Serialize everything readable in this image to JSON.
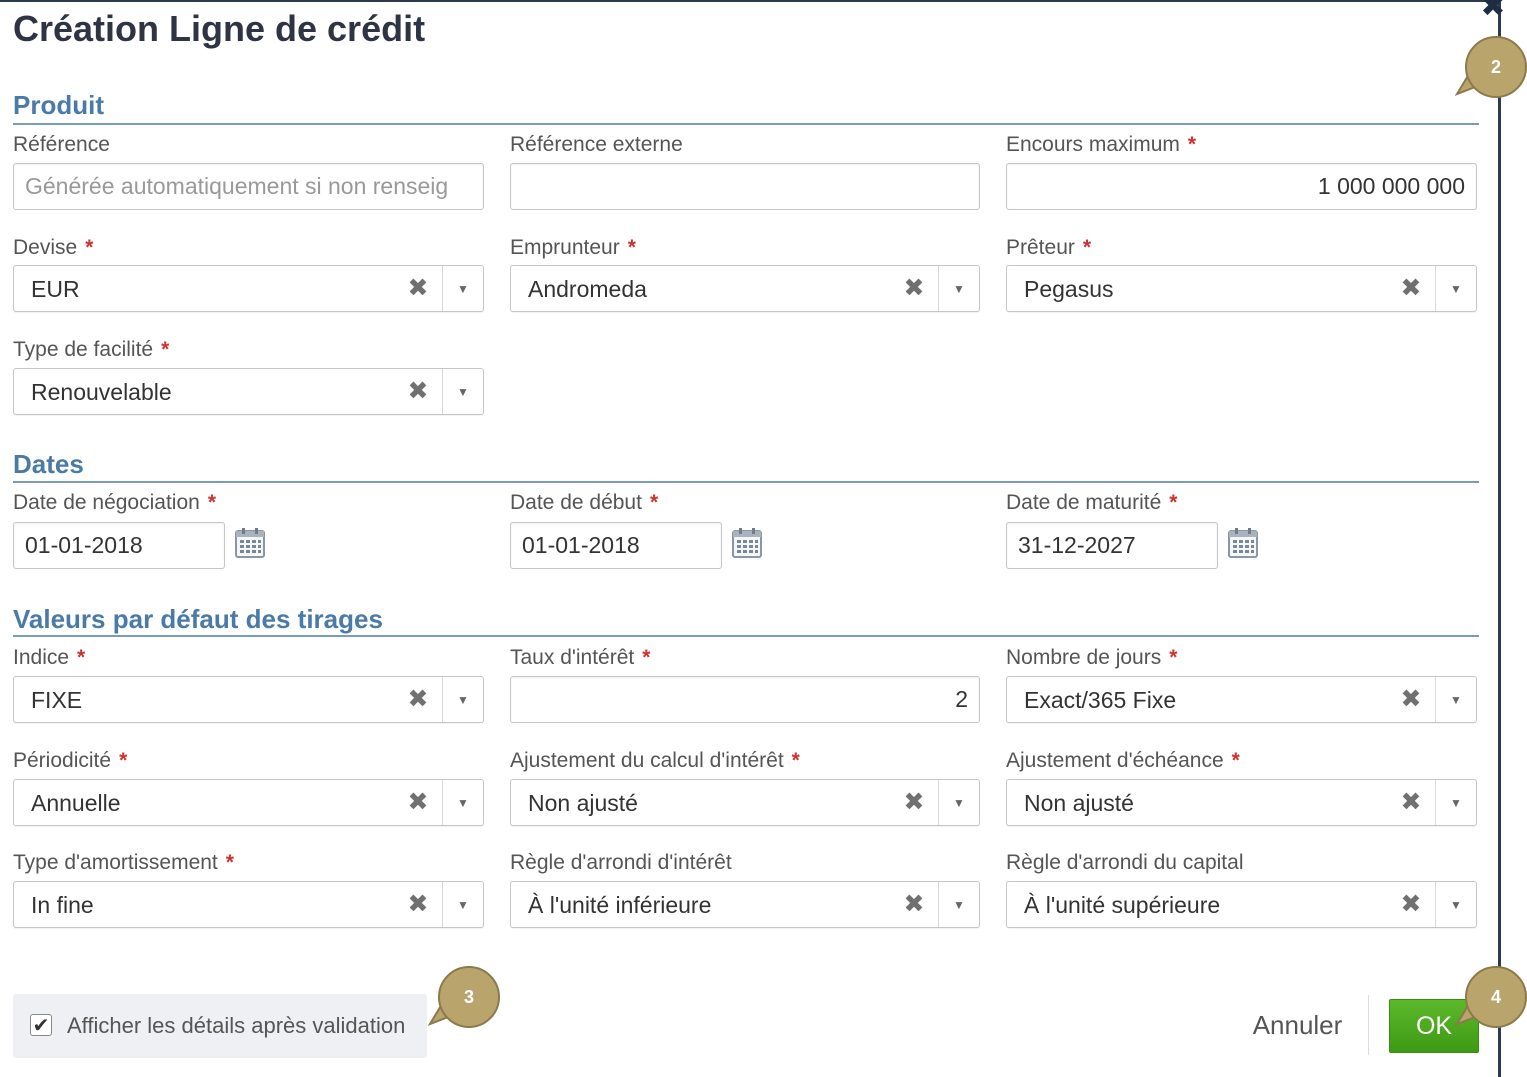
{
  "dialog": {
    "title": "Création Ligne de crédit",
    "close_icon": "close-icon"
  },
  "required_mark": "*",
  "sections": {
    "produit": "Produit",
    "dates": "Dates",
    "tirages": "Valeurs par défaut des tirages"
  },
  "produit": {
    "reference": {
      "label": "Référence",
      "placeholder": "Générée automatiquement si non renseig",
      "value": ""
    },
    "reference_externe": {
      "label": "Référence externe",
      "value": ""
    },
    "encours_maximum": {
      "label": "Encours maximum",
      "value": "1 000 000 000"
    },
    "devise": {
      "label": "Devise",
      "value": "EUR"
    },
    "emprunteur": {
      "label": "Emprunteur",
      "value": "Andromeda"
    },
    "preteur": {
      "label": "Prêteur",
      "value": "Pegasus"
    },
    "type_facilite": {
      "label": "Type de facilité",
      "value": "Renouvelable"
    }
  },
  "dates": {
    "negociation": {
      "label": "Date de négociation",
      "value": "01-01-2018"
    },
    "debut": {
      "label": "Date de début",
      "value": "01-01-2018"
    },
    "maturite": {
      "label": "Date de maturité",
      "value": "31-12-2027"
    }
  },
  "tirages": {
    "indice": {
      "label": "Indice",
      "value": "FIXE"
    },
    "taux_interet": {
      "label": "Taux d'intérêt",
      "value": "2"
    },
    "nombre_jours": {
      "label": "Nombre de jours",
      "value": "Exact/365 Fixe"
    },
    "periodicite": {
      "label": "Périodicité",
      "value": "Annuelle"
    },
    "ajustement_calcul": {
      "label": "Ajustement du calcul d'intérêt",
      "value": "Non ajusté"
    },
    "ajustement_echeance": {
      "label": "Ajustement d'échéance",
      "value": "Non ajusté"
    },
    "type_amortissement": {
      "label": "Type d'amortissement",
      "value": "In fine"
    },
    "regle_arrondi_interet": {
      "label": "Règle d'arrondi d'intérêt",
      "value": "À l'unité inférieure"
    },
    "regle_arrondi_capital": {
      "label": "Règle d'arrondi du capital",
      "value": "À l'unité supérieure"
    }
  },
  "footer": {
    "show_details_label": "Afficher les détails après validation",
    "show_details_checked": true,
    "cancel_label": "Annuler",
    "ok_label": "OK"
  },
  "callouts": {
    "c2": "2",
    "c3": "3",
    "c4": "4"
  },
  "icons": {
    "clear": "✖",
    "dropdown": "▼",
    "check": "✔"
  },
  "colors": {
    "section_title": "#4a7aa7",
    "required": "#d0312d",
    "ok_button": "#4caa1e",
    "callout": "#b9a46c"
  }
}
